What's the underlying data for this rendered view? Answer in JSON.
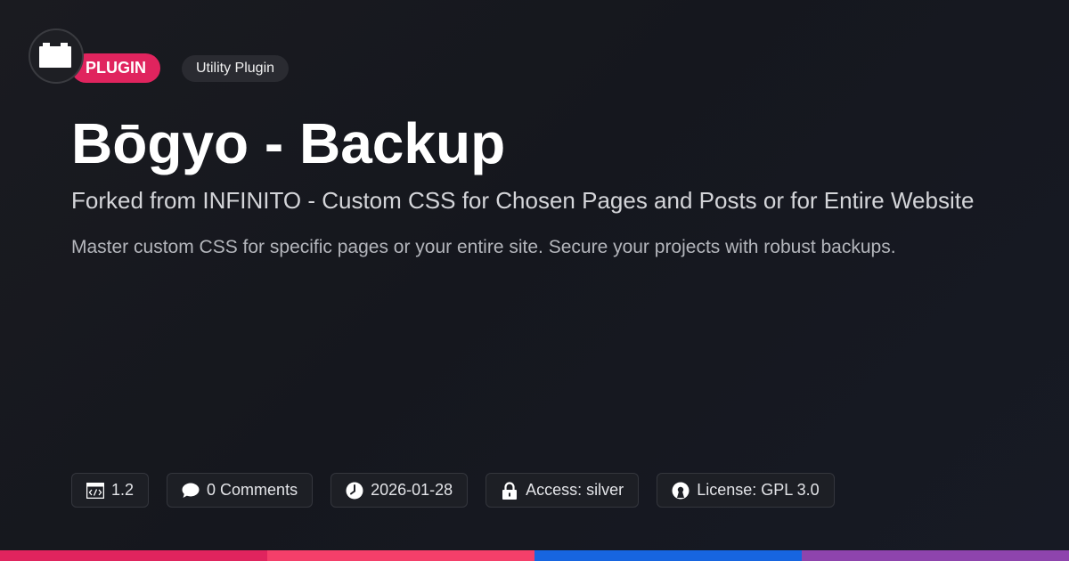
{
  "badge": {
    "type_label": "PLUGIN",
    "category_label": "Utility Plugin"
  },
  "header": {
    "title": "Bōgyo - Backup",
    "subtitle": "Forked from INFINITO - Custom CSS for Chosen Pages and Posts or for Entire Website",
    "description": "Master custom CSS for specific pages or your entire site. Secure your projects with robust backups."
  },
  "meta": {
    "version": "1.2",
    "comments": "0 Comments",
    "date": "2026-01-28",
    "access": "Access: silver",
    "license": "License: GPL 3.0"
  },
  "icons": {
    "logo": "briefcase-icon",
    "version": "code-window-icon",
    "comments": "speech-bubble-icon",
    "date": "clock-icon",
    "access": "lock-icon",
    "license": "open-source-icon"
  },
  "colors": {
    "plugin_pill": "#e0245e",
    "bar": [
      "#e0245e",
      "#f43f6a",
      "#1765e0",
      "#8e44ad"
    ]
  }
}
